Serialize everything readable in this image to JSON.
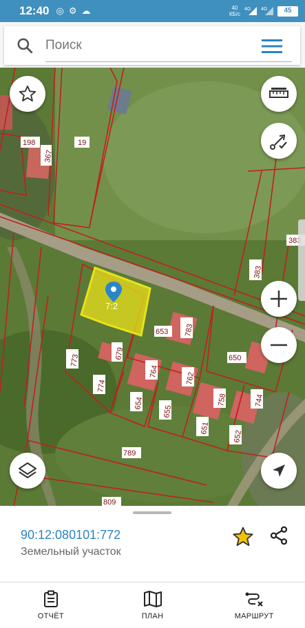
{
  "status_bar": {
    "time": "12:40",
    "net_speed_value": "40",
    "net_speed_unit": "КБ/с",
    "net_type_1": "4G",
    "net_type_2": "4G",
    "battery": "45"
  },
  "search": {
    "placeholder": "Поиск"
  },
  "map": {
    "parcel_labels": [
      "198",
      "367",
      "19",
      "383",
      "383",
      "772",
      "653",
      "783",
      "650",
      "773",
      "679",
      "774",
      "764",
      "762",
      "654",
      "655",
      "758",
      "744",
      "651",
      "652",
      "789",
      "809"
    ],
    "selected_parcel_label": "7:2",
    "highlight_color": "#e9e21a",
    "boundary_color": "#c0201f"
  },
  "object": {
    "cadastral_number": "90:12:080101:772",
    "type": "Земельный участок"
  },
  "nav": {
    "report_label": "ОТЧЁТ",
    "plan_label": "ПЛАН",
    "route_label": "МАРШРУТ"
  },
  "colors": {
    "accent": "#2b83c4",
    "status_bar": "#3f8fbf",
    "star": "#f2c200"
  }
}
